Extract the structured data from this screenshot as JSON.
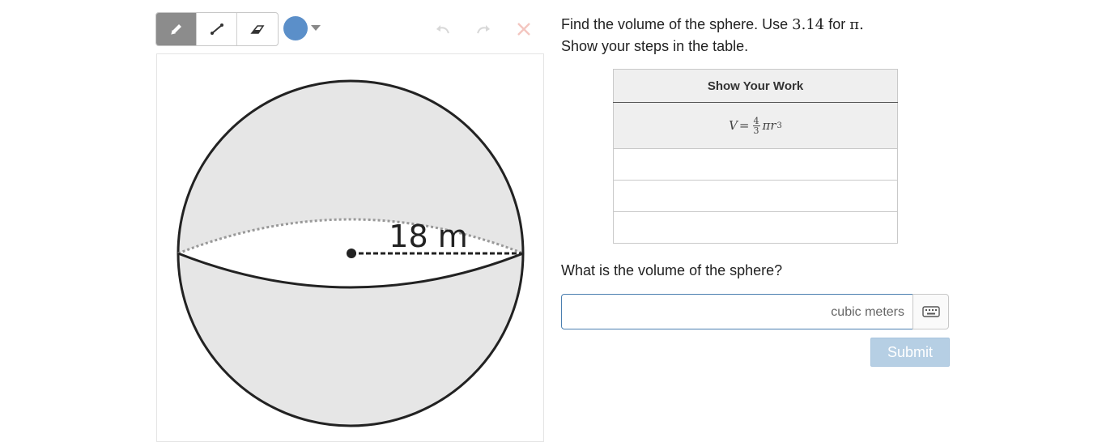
{
  "toolbar": {
    "tools": [
      {
        "icon": "pencil-icon",
        "active": true
      },
      {
        "icon": "line-icon",
        "active": false
      },
      {
        "icon": "eraser-icon",
        "active": false
      }
    ],
    "color": "#5b8fc9",
    "undo_icon": "undo-icon",
    "redo_icon": "redo-icon",
    "clear_icon": "close-icon"
  },
  "figure": {
    "radius_label": "18 m"
  },
  "prompt": {
    "line1_a": "Find the volume of the sphere. Use ",
    "pi_value": "3.14",
    "line1_b": " for ",
    "pi_symbol": "π",
    "line1_c": ".",
    "line2": "Show your steps in the table."
  },
  "work_table": {
    "header": "Show Your Work",
    "formula": {
      "lhs": "V",
      "eq": "=",
      "numerator": "4",
      "denominator": "3",
      "pi": "π",
      "var": "r",
      "exponent": "3"
    },
    "empty_rows": [
      "",
      "",
      ""
    ]
  },
  "question": "What is the volume of the sphere?",
  "answer": {
    "value": "",
    "unit": "cubic meters",
    "keyboard_icon": "keyboard-icon"
  },
  "submit_label": "Submit",
  "colors": {
    "accent": "#4b7fb0",
    "submit_disabled": "#b6cfe4",
    "sphere_fill": "#e6e6e6",
    "clear_icon": "#f3c6c0"
  }
}
